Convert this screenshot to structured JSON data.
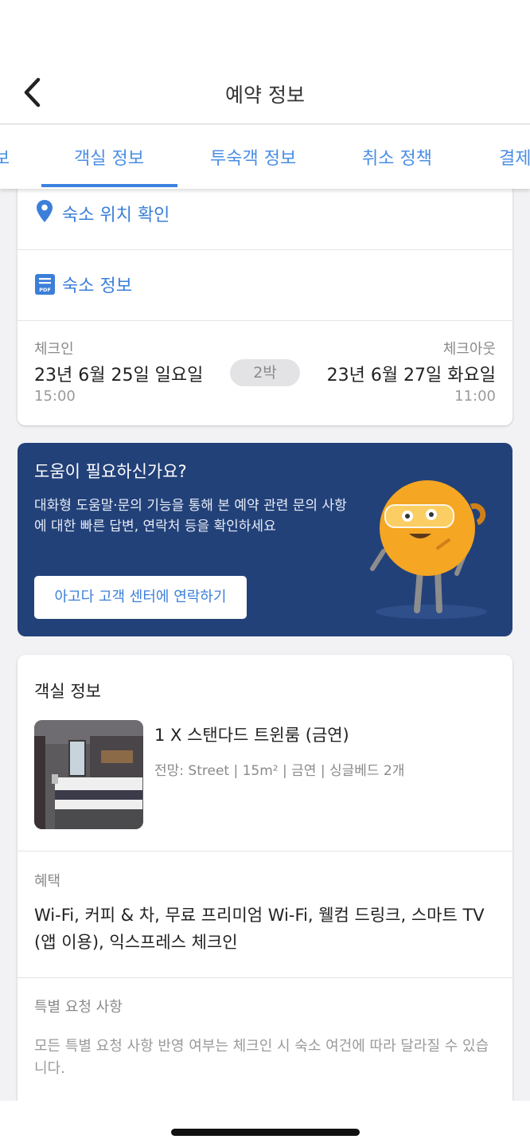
{
  "header": {
    "title": "예약 정보"
  },
  "tabs": [
    {
      "label": "보"
    },
    {
      "label": "객실 정보",
      "active": true
    },
    {
      "label": "투숙객 정보"
    },
    {
      "label": "취소 정책"
    },
    {
      "label": "결제"
    }
  ],
  "property": {
    "location_link": "숙소 위치 확인",
    "info_link": "숙소 정보",
    "pdf_icon_text": "PDF"
  },
  "stay": {
    "checkin_label": "체크인",
    "checkin_date": "23년 6월 25일 일요일",
    "checkin_time": "15:00",
    "nights": "2박",
    "checkout_label": "체크아웃",
    "checkout_date": "23년 6월 27일 화요일",
    "checkout_time": "11:00"
  },
  "help": {
    "title": "도움이 필요하신가요?",
    "description": "대화형 도움말·문의 기능을 통해 본 예약 관련 문의 사항에 대한 빠른 답변, 연락처 등을 확인하세요",
    "button_label": "아고다 고객 센터에 연락하기"
  },
  "room": {
    "section_title": "객실 정보",
    "name": "1 X 스탠다드 트윈룸 (금연)",
    "details": "전망: Street | 15m² | 금연 | 싱글베드 2개",
    "benefits_label": "혜택",
    "benefits": "Wi-Fi, 커피 & 차, 무료 프리미엄 Wi-Fi, 웰컴 드링크, 스마트 TV (앱 이용), 익스프레스 체크인",
    "special_label": "특별 요청 사항",
    "special_text": "모든 특별 요청 사항 반영 여부는 체크인 시 숙소 여건에 따라 달라질 수 있습니다."
  },
  "colors": {
    "accent": "#3b7fd9",
    "help_bg": "#234179",
    "mascot": "#f5a623"
  },
  "icons": [
    "back-arrow-icon",
    "map-pin-icon",
    "pdf-document-icon"
  ]
}
